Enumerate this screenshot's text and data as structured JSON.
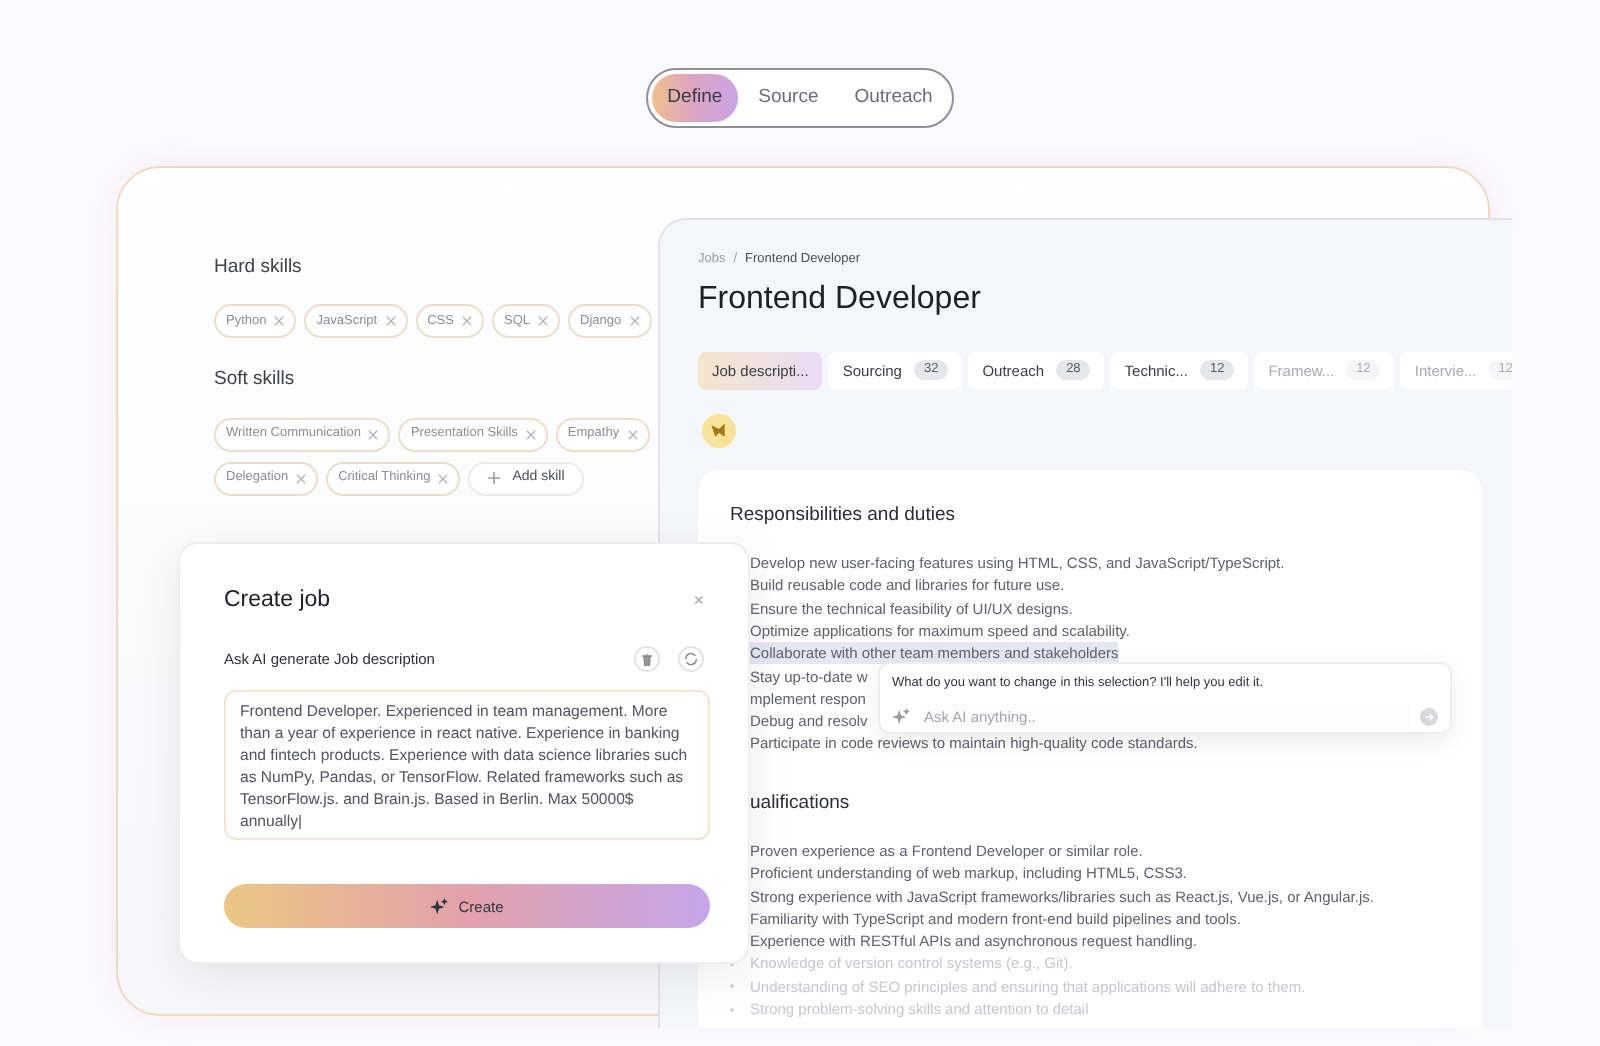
{
  "nav": {
    "tabs": [
      {
        "label": "Define",
        "selected": true
      },
      {
        "label": "Source",
        "selected": false
      },
      {
        "label": "Outreach",
        "selected": false
      }
    ]
  },
  "skills": {
    "sections": [
      {
        "title": "Hard skills",
        "rows": [
          [
            "Python",
            "JavaScript",
            "CSS",
            "SQL",
            "Django"
          ]
        ]
      },
      {
        "title": "Soft skills",
        "rows": [
          [
            "Written Communication",
            "Presentation Skills",
            "Empathy"
          ],
          [
            "Delegation",
            "Critical Thinking"
          ]
        ]
      }
    ],
    "add_label": "Add skill"
  },
  "job": {
    "breadcrumb": [
      "Jobs",
      "Frontend Developer"
    ],
    "breadcrumb_separator": "/",
    "title": "Frontend Developer",
    "stages": [
      {
        "label": "Job descripti...",
        "selected": true,
        "disabled": false
      },
      {
        "label": "Sourcing",
        "count": "32",
        "selected": false,
        "disabled": false
      },
      {
        "label": "Outreach",
        "count": "28",
        "selected": false,
        "disabled": false
      },
      {
        "label": "Technic...",
        "count": "12",
        "selected": false,
        "disabled": false
      },
      {
        "label": "Framew...",
        "count": "12",
        "selected": false,
        "disabled": true
      },
      {
        "label": "Intervie...",
        "count": "12",
        "selected": false,
        "disabled": true
      }
    ],
    "sections": [
      {
        "title": "Responsibilities and duties",
        "items": [
          {
            "text": "Develop new user-facing features using HTML, CSS, and JavaScript/TypeScript.",
            "highlighted": false,
            "faded": false
          },
          {
            "text": "Build reusable code and libraries for future use.",
            "highlighted": false,
            "faded": false
          },
          {
            "text": "Ensure the technical feasibility of UI/UX designs.",
            "highlighted": false,
            "faded": false
          },
          {
            "text": "Optimize applications for maximum speed and scalability.",
            "highlighted": false,
            "faded": false
          },
          {
            "text": "Collaborate with other team members and stakeholders",
            "highlighted": true,
            "faded": false
          },
          {
            "text": "Stay up-to-date w",
            "highlighted": false,
            "faded": false
          },
          {
            "text": "mplement respon",
            "highlighted": false,
            "faded": false
          },
          {
            "text": "Debug and resolv",
            "highlighted": false,
            "faded": false
          },
          {
            "text": "Participate in code reviews to maintain high-quality code standards.",
            "highlighted": false,
            "faded": false
          }
        ]
      },
      {
        "title": "ualifications",
        "items": [
          {
            "text": "Proven experience as a Frontend Developer or similar role.",
            "highlighted": false,
            "faded": false
          },
          {
            "text": "Proficient understanding of web markup, including HTML5, CSS3.",
            "highlighted": false,
            "faded": false
          },
          {
            "text": "Strong experience with JavaScript frameworks/libraries such as React.js, Vue.js, or Angular.js.",
            "highlighted": false,
            "faded": false
          },
          {
            "text": "Familiarity with TypeScript and modern front-end build pipelines and tools.",
            "highlighted": false,
            "faded": false
          },
          {
            "text": "Experience with RESTful APIs and asynchronous request handling.",
            "highlighted": false,
            "faded": false
          },
          {
            "text": "Knowledge of version control systems (e.g., Git).",
            "highlighted": false,
            "faded": true
          },
          {
            "text": "Understanding of SEO principles and ensuring that applications will adhere to them.",
            "highlighted": false,
            "faded": true
          },
          {
            "text": "Strong problem-solving skills and attention to detail",
            "highlighted": false,
            "faded": true
          }
        ]
      }
    ]
  },
  "ai_popup": {
    "question": "What do you want to change in this selection? I'll help you edit it.",
    "placeholder": "Ask AI anything.."
  },
  "modal": {
    "title": "Create job",
    "close": "×",
    "label": "Ask AI generate Job description",
    "value": "Frontend Developer. Experienced in team management. More than a year of experience in react native. Experience in banking and fintech products. Experience with data science libraries such as NumPy, Pandas, or TensorFlow. Related frameworks such as TensorFlow.js. and Brain.js. Based in Berlin. Max 50000$ annually|",
    "button": "Create"
  }
}
